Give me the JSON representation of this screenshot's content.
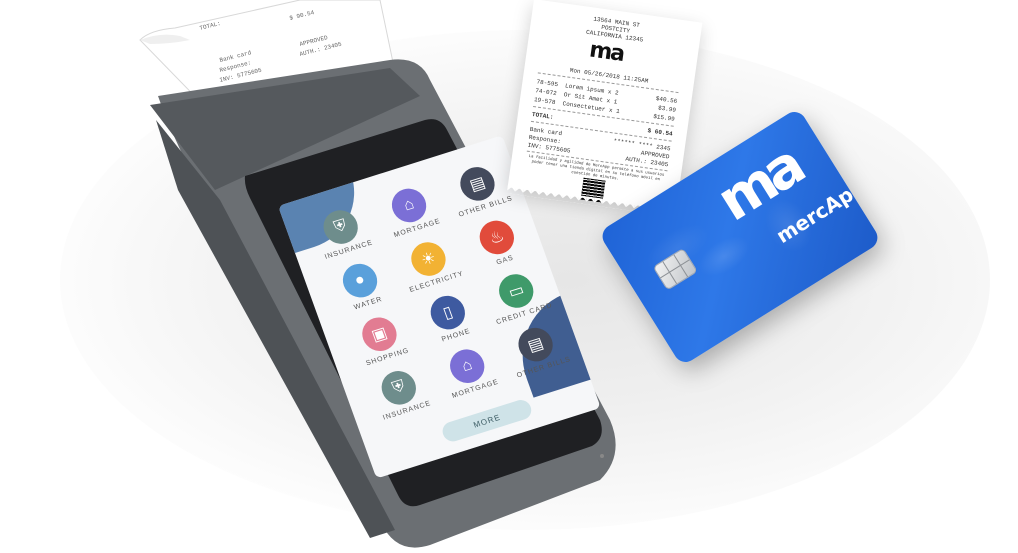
{
  "screen": {
    "tiles": [
      {
        "label": "INSURANCE",
        "icon": "shield-icon",
        "color": "#6e8d8c",
        "glyph": "⛨"
      },
      {
        "label": "MORTGAGE",
        "icon": "house-icon",
        "color": "#7b6fd6",
        "glyph": "⌂"
      },
      {
        "label": "OTHER BILLS",
        "icon": "document-icon",
        "color": "#434a5c",
        "glyph": "▤"
      },
      {
        "label": "WATER",
        "icon": "water-drop-icon",
        "color": "#5aa0db",
        "glyph": "💧"
      },
      {
        "label": "ELECTRICITY",
        "icon": "lightbulb-icon",
        "color": "#f2b233",
        "glyph": "💡"
      },
      {
        "label": "GAS",
        "icon": "flame-icon",
        "color": "#e14b3b",
        "glyph": "🔥"
      },
      {
        "label": "SHOPPING",
        "icon": "shopping-bag-icon",
        "color": "#e27c92",
        "glyph": "🛍"
      },
      {
        "label": "PHONE",
        "icon": "phone-icon",
        "color": "#3e5aa0",
        "glyph": "▯"
      },
      {
        "label": "CREDIT CARD",
        "icon": "credit-card-icon",
        "color": "#3f9a6a",
        "glyph": "▭"
      },
      {
        "label": "INSURANCE",
        "icon": "shield-icon",
        "color": "#6e8d8c",
        "glyph": "⛨"
      },
      {
        "label": "MORTGAGE",
        "icon": "house-icon",
        "color": "#7b6fd6",
        "glyph": "⌂"
      },
      {
        "label": "OTHER BILLS",
        "icon": "document-icon",
        "color": "#434a5c",
        "glyph": "▤"
      }
    ],
    "more_label": "MORE"
  },
  "receipt": {
    "address": [
      "13564 MAIN ST",
      "POSTCITY",
      "CALIFORNIA 12345"
    ],
    "date_line": "Mon  05/26/2018  11:25AM",
    "items": [
      {
        "code": "78-595",
        "desc": "Lorem ipsum x 2",
        "price": "$40.56"
      },
      {
        "code": "74-072",
        "desc": "Or Sit Amet x 1",
        "price": "$3.99"
      },
      {
        "code": "19-578",
        "desc": "Consectetuer x 1",
        "price": "$15.99"
      }
    ],
    "total_label": "TOTAL:",
    "total_value": "$ 60.54",
    "bank_card": "Bank card",
    "card_mask": "****** **** 2345",
    "response_label": "Response:",
    "response_value": "APPROVED",
    "inv": "INV: 5775605",
    "auth": "AUTH.: 23405",
    "footer": "La facilidad y agilidad de MercApp permite a sus usuarios poder tener una tienda digital en su teléfono móvil en cuestión de minutos."
  },
  "card": {
    "logo": "ma",
    "brand": "mercApp",
    "color": "#2e78e8"
  }
}
